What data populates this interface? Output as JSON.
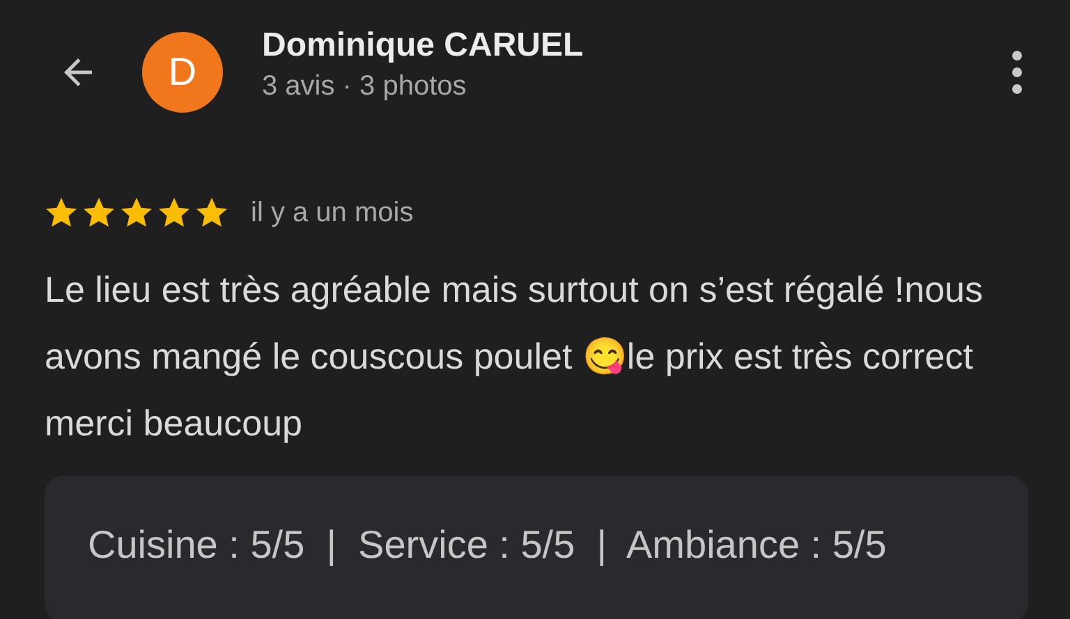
{
  "header": {
    "avatar_letter": "D",
    "name": "Dominique CARUEL",
    "subtitle": "3 avis · 3 photos"
  },
  "review": {
    "stars": 5,
    "time": "il y a un mois",
    "text": "Le lieu est très agréable mais surtout on s’est régalé !nous avons mangé le couscous poulet 😋le prix est très correct merci beaucoup"
  },
  "ratings": "Cuisine : 5/5  |  Service : 5/5  |  Ambiance : 5/5"
}
